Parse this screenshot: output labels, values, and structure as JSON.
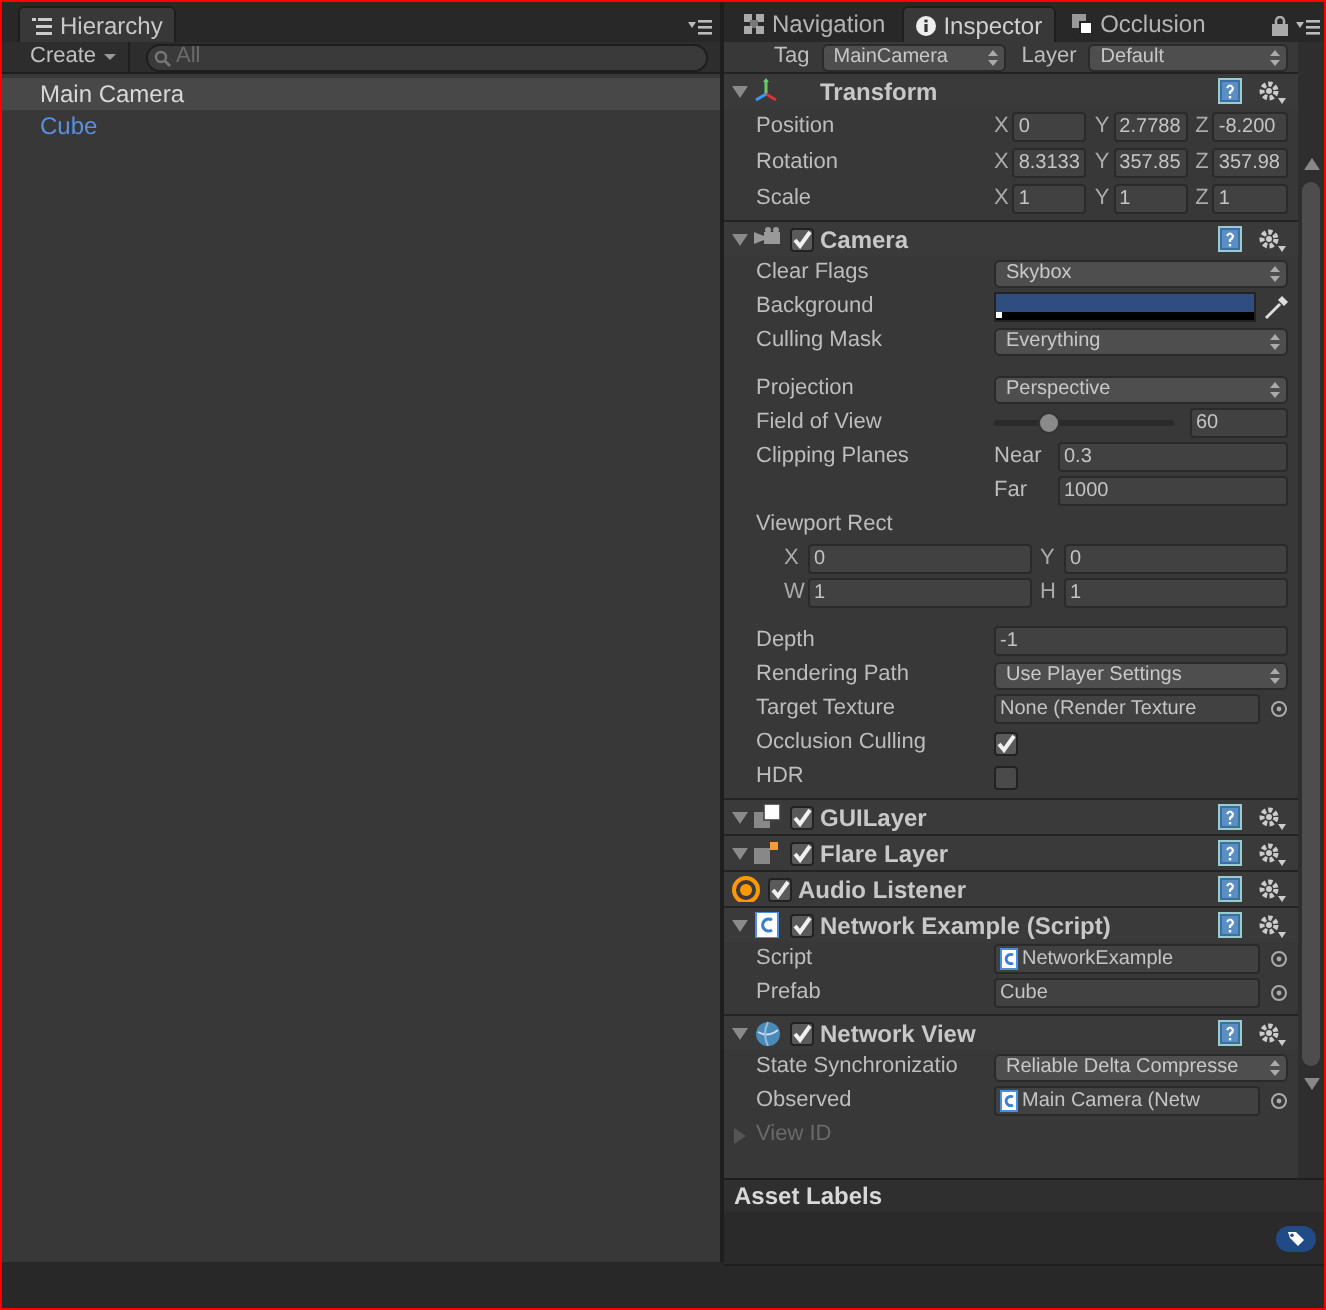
{
  "hierarchy": {
    "tab": "Hierarchy",
    "create": "Create",
    "search_placeholder": "All",
    "items": [
      {
        "label": "Main Camera",
        "kind": "object",
        "selected": true
      },
      {
        "label": "Cube",
        "kind": "prefab",
        "selected": false
      }
    ]
  },
  "inspector": {
    "tabs": [
      {
        "label": "Navigation",
        "selected": false
      },
      {
        "label": "Inspector",
        "selected": true
      },
      {
        "label": "Occlusion",
        "selected": false
      }
    ],
    "header": {
      "tag_label": "Tag",
      "tag": "MainCamera",
      "layer_label": "Layer",
      "layer": "Default"
    },
    "components": [
      {
        "title": "Transform",
        "kind": "transform",
        "expanded": true,
        "groups": [
          [
            {
              "kind": "vector3",
              "label": "Position",
              "fields": [
                {
                  "axis": "X",
                  "value": "0"
                },
                {
                  "axis": "Y",
                  "value": "2.7788"
                },
                {
                  "axis": "Z",
                  "value": "-8.200"
                }
              ]
            },
            {
              "kind": "vector3",
              "label": "Rotation",
              "fields": [
                {
                  "axis": "X",
                  "value": "8.3133"
                },
                {
                  "axis": "Y",
                  "value": "357.85"
                },
                {
                  "axis": "Z",
                  "value": "357.98"
                }
              ]
            },
            {
              "kind": "vector3",
              "label": "Scale",
              "fields": [
                {
                  "axis": "X",
                  "value": "1"
                },
                {
                  "axis": "Y",
                  "value": "1"
                },
                {
                  "axis": "Z",
                  "value": "1"
                }
              ]
            }
          ]
        ]
      },
      {
        "title": "Camera",
        "kind": "camera",
        "expanded": true,
        "enabled": true,
        "groups": [
          [
            {
              "kind": "dropdown",
              "label": "Clear Flags",
              "value": "Skybox"
            },
            {
              "kind": "color",
              "label": "Background",
              "color": "#2f4d7f"
            },
            {
              "kind": "dropdown",
              "label": "Culling Mask",
              "value": "Everything"
            }
          ],
          [
            {
              "kind": "dropdown",
              "label": "Projection",
              "value": "Perspective"
            },
            {
              "kind": "slider",
              "label": "Field of View",
              "level": 0.3,
              "value": "60"
            },
            {
              "kind": "planes",
              "label": "Clipping Planes",
              "fields": [
                {
                  "axis": "Near",
                  "value": "0.3"
                },
                {
                  "axis": "Far",
                  "value": "1000"
                }
              ]
            },
            {
              "kind": "rect",
              "label": "Viewport Rect",
              "fields": [
                {
                  "axis": "X",
                  "value": "0"
                },
                {
                  "axis": "Y",
                  "value": "0"
                },
                {
                  "axis": "W",
                  "value": "1"
                },
                {
                  "axis": "H",
                  "value": "1"
                }
              ]
            }
          ],
          [
            {
              "kind": "field",
              "label": "Depth",
              "value": "-1"
            },
            {
              "kind": "dropdown",
              "label": "Rendering Path",
              "value": "Use Player Settings"
            },
            {
              "kind": "object",
              "label": "Target Texture",
              "value": "None (Render Texture",
              "asset": false
            },
            {
              "kind": "checkbox",
              "label": "Occlusion Culling",
              "checked": true
            },
            {
              "kind": "checkbox",
              "label": "HDR",
              "checked": false
            }
          ]
        ]
      },
      {
        "title": "GUILayer",
        "kind": "guilayer",
        "expanded": true,
        "enabled": true
      },
      {
        "title": "Flare Layer",
        "kind": "flare",
        "expanded": true,
        "enabled": true
      },
      {
        "title": "Audio Listener",
        "kind": "audio",
        "enabled": true
      },
      {
        "title": "Network Example (Script)",
        "kind": "script",
        "expanded": true,
        "enabled": true,
        "groups": [
          [
            {
              "kind": "object",
              "label": "Script",
              "value": "NetworkExample",
              "asset": true
            },
            {
              "kind": "object",
              "label": "Prefab",
              "value": "Cube",
              "asset": false
            }
          ]
        ]
      },
      {
        "title": "Network View",
        "kind": "network",
        "expanded": true,
        "enabled": true,
        "groups": [
          [
            {
              "kind": "dropdown",
              "label": "State Synchronizatio",
              "value": "Reliable Delta Compresse"
            },
            {
              "kind": "object",
              "label": "Observed",
              "value": "Main Camera (Netw",
              "asset": true
            },
            {
              "kind": "foldout",
              "label": "View ID",
              "expanded": false
            }
          ]
        ]
      }
    ],
    "asset_labels": "Asset Labels"
  }
}
